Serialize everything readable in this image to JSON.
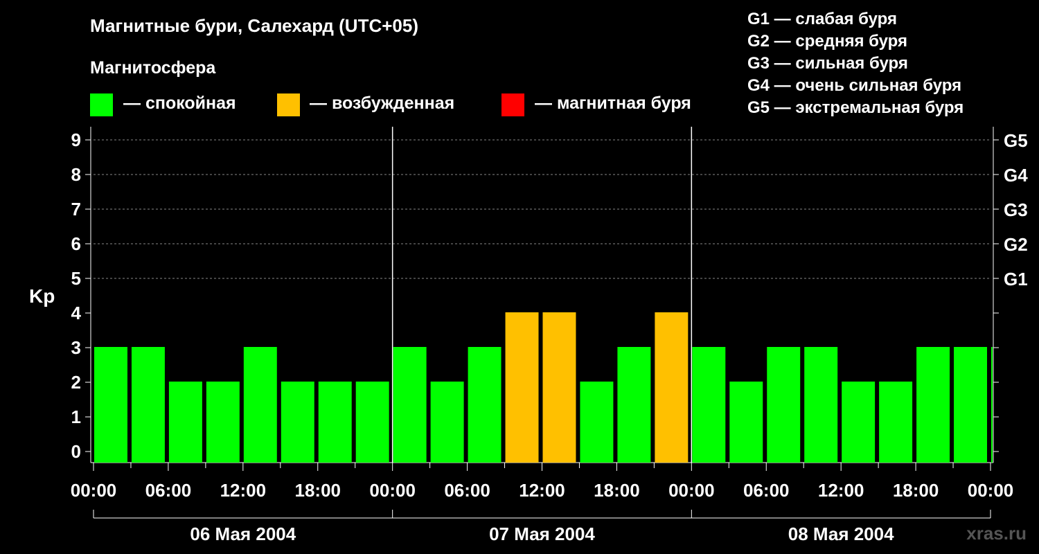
{
  "title": "Магнитные бури, Салехард (UTC+05)",
  "subtitle": "Магнитосфера",
  "legend": [
    {
      "label": "— спокойная",
      "color": "#00ff00"
    },
    {
      "label": "— возбужденная",
      "color": "#ffc000"
    },
    {
      "label": "— магнитная буря",
      "color": "#ff0000"
    }
  ],
  "g_legend": [
    "G1 — слабая буря",
    "G2 — средняя буря",
    "G3 — сильная буря",
    "G4 — очень сильная буря",
    "G5 — экстремальная буря"
  ],
  "watermark": "xras.ru",
  "chart_data": {
    "type": "bar",
    "ylabel": "Kp",
    "ylim": [
      0,
      9
    ],
    "yticks": [
      "0",
      "1",
      "2",
      "3",
      "4",
      "5",
      "6",
      "7",
      "8",
      "9"
    ],
    "right_labels": [
      {
        "kp": 5,
        "label": "G1"
      },
      {
        "kp": 6,
        "label": "G2"
      },
      {
        "kp": 7,
        "label": "G3"
      },
      {
        "kp": 8,
        "label": "G4"
      },
      {
        "kp": 9,
        "label": "G5"
      }
    ],
    "xtick_labels": [
      "00:00",
      "06:00",
      "12:00",
      "18:00",
      "00:00",
      "06:00",
      "12:00",
      "18:00",
      "00:00",
      "06:00",
      "12:00",
      "18:00",
      "00:00"
    ],
    "days": [
      "06 Мая 2004",
      "07 Мая 2004",
      "08 Мая 2004"
    ],
    "interval_hours": 3,
    "values": [
      3,
      3,
      2,
      2,
      3,
      2,
      2,
      2,
      3,
      2,
      3,
      4,
      4,
      2,
      3,
      4,
      3,
      2,
      3,
      3,
      2,
      2,
      3,
      3,
      3
    ],
    "colors": {
      "quiet": "#00ff00",
      "active": "#ffc000",
      "storm": "#ff0000"
    },
    "grid": true
  }
}
